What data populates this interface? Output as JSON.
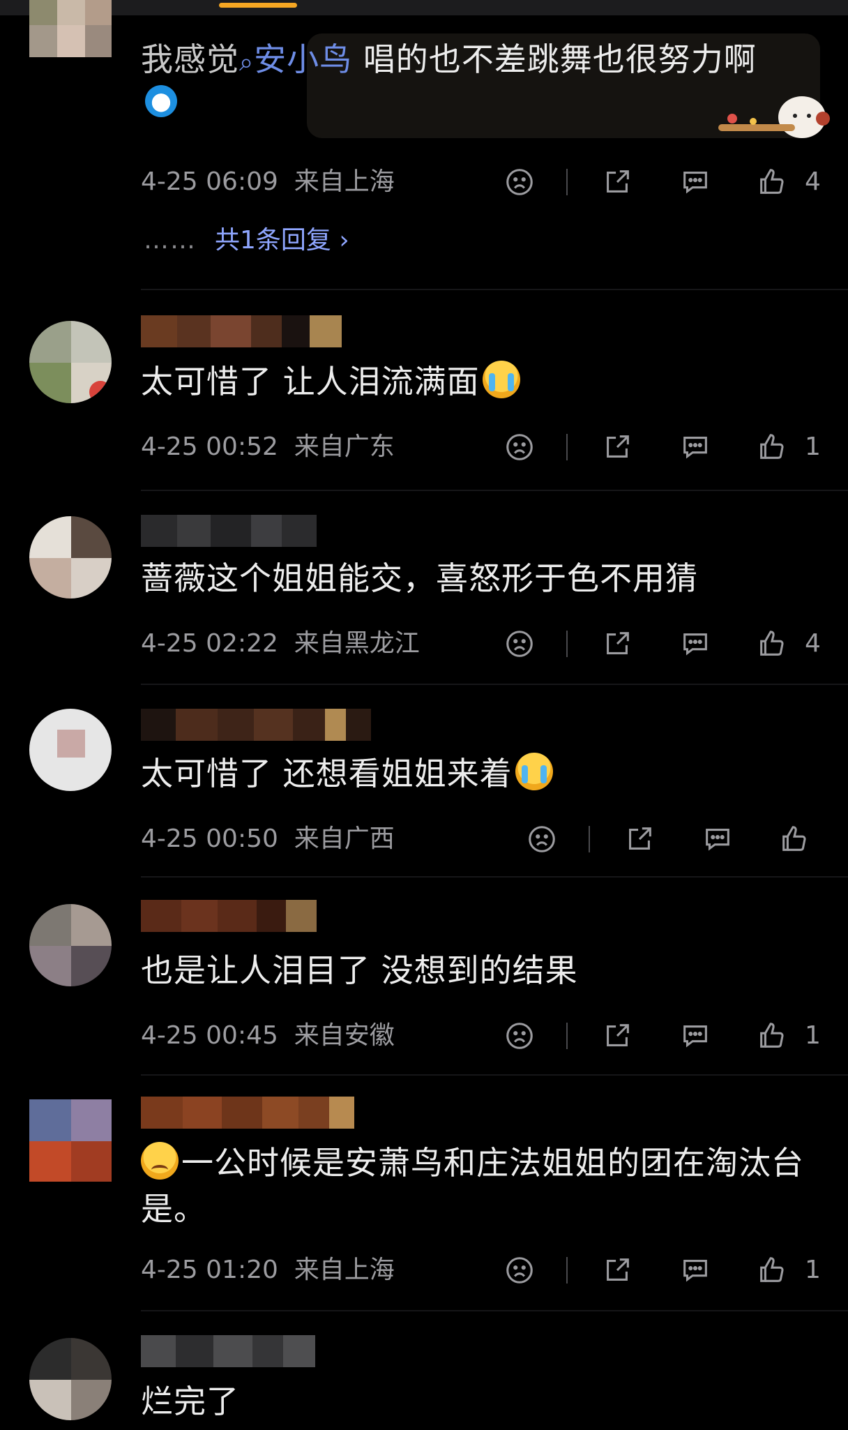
{
  "comments": [
    {
      "text_prefix": "我感觉",
      "mention": "安小鸟",
      "text_suffix": " 唱的也不差跳舞也很努力啊",
      "time": "4-25 06:09",
      "location": "来自上海",
      "likes": "4",
      "replies": {
        "dots": "……",
        "label": "共1条回复 ›"
      }
    },
    {
      "text": "太可惜了 让人泪流满面",
      "time": "4-25 00:52",
      "location": "来自广东",
      "likes": "1"
    },
    {
      "text": "蔷薇这个姐姐能交，喜怒形于色不用猜",
      "time": "4-25 02:22",
      "location": "来自黑龙江",
      "likes": "4"
    },
    {
      "text": "太可惜了 还想看姐姐来着",
      "time": "4-25 00:50",
      "location": "来自广西",
      "likes": ""
    },
    {
      "text": "也是让人泪目了 没想到的结果",
      "time": "4-25 00:45",
      "location": "来自安徽",
      "likes": "1"
    },
    {
      "text": "一公时候是安萧鸟和庄法姐姐的团在淘汰台是。",
      "time": "4-25 01:20",
      "location": "来自上海",
      "likes": "1"
    },
    {
      "text": "烂完了"
    }
  ],
  "icons": {
    "dislike": "frown-face-icon",
    "share": "share-icon",
    "comment": "comment-bubble-icon",
    "like": "thumbs-up-icon"
  },
  "colors": {
    "background": "#000000",
    "text": "#ededed",
    "meta": "#9c9ca0",
    "mention": "#6e8de6",
    "reply_link": "#8fa6ff",
    "tab_indicator": "#f5a623"
  }
}
